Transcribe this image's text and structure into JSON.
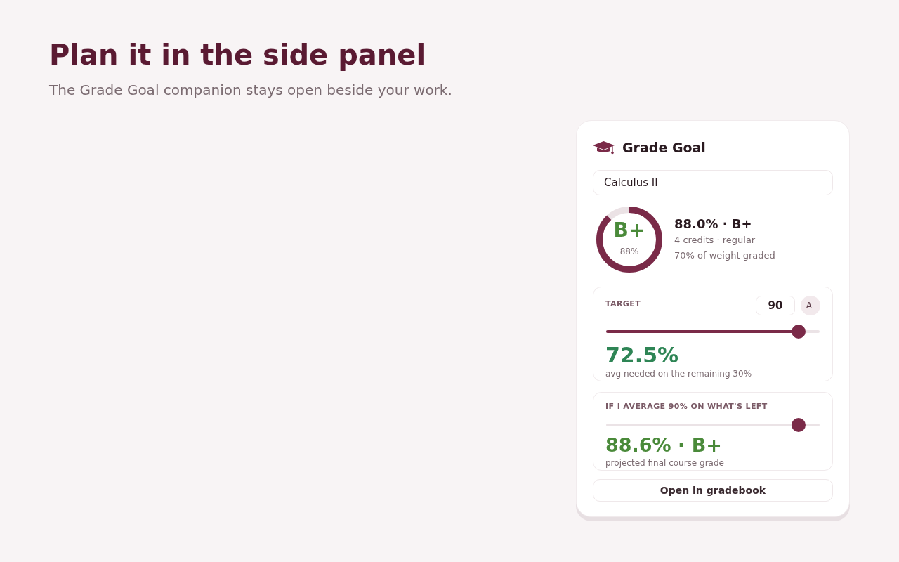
{
  "hero": {
    "title": "Plan it in the side panel",
    "subtitle": "The Grade Goal companion stays open beside your work."
  },
  "panel": {
    "title": "Grade Goal",
    "course": {
      "value": "Calculus II"
    },
    "summary": {
      "ring": {
        "level": 0.88,
        "grade": "B+",
        "percent": "88%"
      },
      "headline": "88.0% · B+",
      "details": [
        "4 credits · regular",
        "70% of weight graded"
      ]
    },
    "target": {
      "label": "TARGET",
      "value": "90",
      "grade_badge": "A-",
      "slider": {
        "level": 0.9,
        "filled": true
      },
      "result": "72.5%",
      "caption": "avg needed on the remaining 30%"
    },
    "projection": {
      "label": "IF I AVERAGE 90% ON WHAT'S LEFT",
      "slider": {
        "level": 0.9,
        "filled": false
      },
      "result": "88.6% · B+",
      "caption": "projected final course grade"
    },
    "button": "Open in gradebook"
  }
}
